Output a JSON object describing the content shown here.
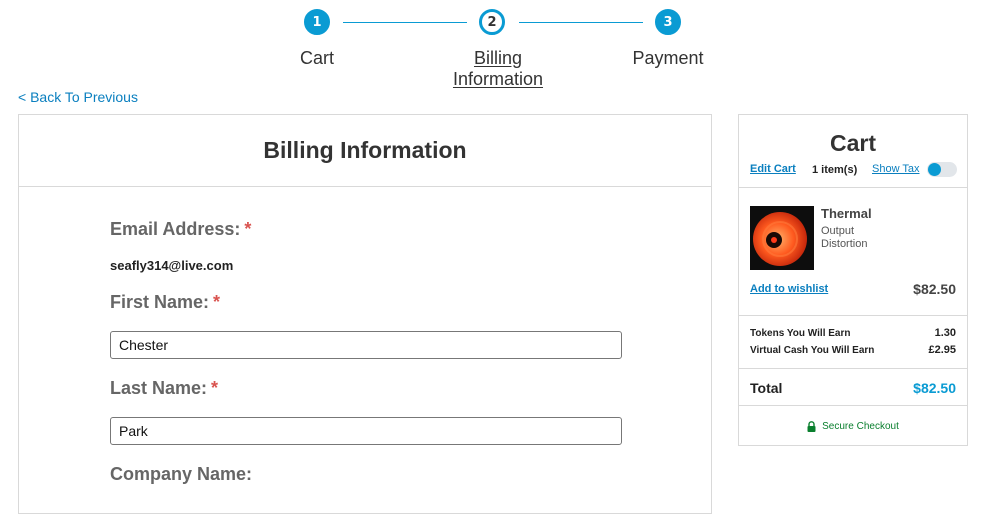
{
  "stepper": {
    "steps": [
      {
        "number": "1",
        "label": "Cart"
      },
      {
        "number": "2",
        "label_line1": "Billing",
        "label_line2": "Information"
      },
      {
        "number": "3",
        "label": "Payment"
      }
    ],
    "active_step": 2
  },
  "back_link": "< Back To Previous",
  "billing": {
    "title": "Billing Information",
    "required_marker": "*",
    "email": {
      "label": "Email Address:",
      "value": "seafly314@live.com"
    },
    "first_name": {
      "label": "First Name:",
      "value": "Chester"
    },
    "last_name": {
      "label": "Last Name:",
      "value": "Park"
    },
    "company": {
      "label": "Company Name:"
    }
  },
  "cart": {
    "title": "Cart",
    "edit_label": "Edit Cart",
    "item_count": "1 item(s)",
    "show_tax_label": "Show Tax",
    "item": {
      "name": "Thermal",
      "line1": "Output",
      "line2": "Distortion",
      "wishlist_label": "Add to wishlist",
      "price": "$82.50"
    },
    "tokens": {
      "label": "Tokens You Will Earn",
      "value": "1.30"
    },
    "virtual_cash": {
      "label": "Virtual Cash You Will Earn",
      "value": "£2.95"
    },
    "total": {
      "label": "Total",
      "value": "$82.50"
    },
    "secure_label": "Secure Checkout"
  },
  "colors": {
    "accent": "#0a9bd3",
    "link": "#0a7fbf",
    "required": "#d9534f",
    "secure": "#0a7f2e"
  }
}
